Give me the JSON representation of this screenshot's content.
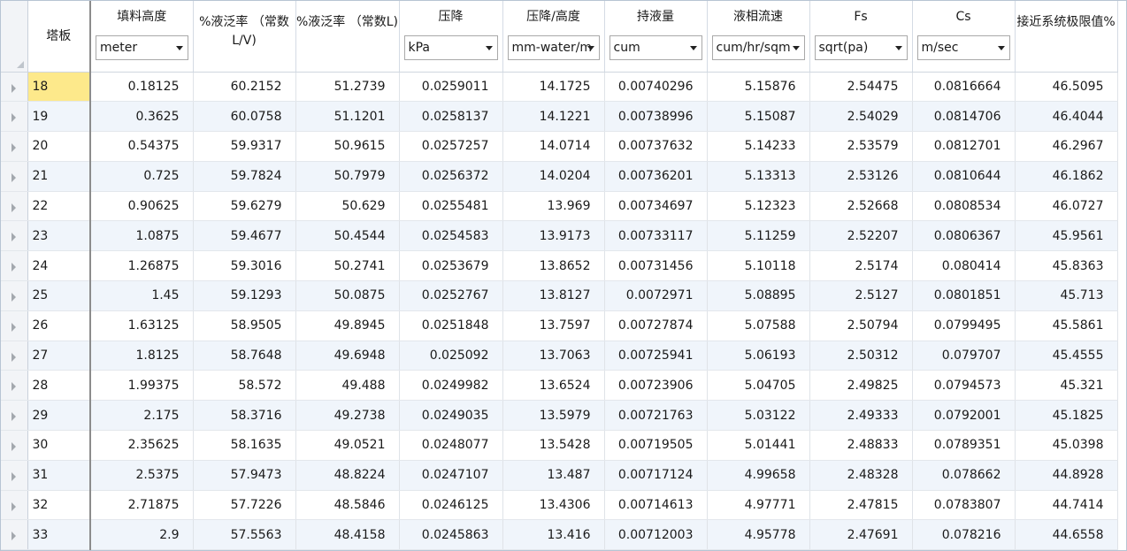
{
  "columns": [
    {
      "label": "塔板",
      "unit": null
    },
    {
      "label": "填料高度",
      "unit": "meter"
    },
    {
      "label": "%液泛率 （常数L/V)",
      "unit": null
    },
    {
      "label": "%液泛率 （常数L)",
      "unit": null
    },
    {
      "label": "压降",
      "unit": "kPa"
    },
    {
      "label": "压降/高度",
      "unit": "mm-water/m"
    },
    {
      "label": "持液量",
      "unit": "cum"
    },
    {
      "label": "液相流速",
      "unit": "cum/hr/sqm"
    },
    {
      "label": "Fs",
      "unit": "sqrt(pa)"
    },
    {
      "label": "Cs",
      "unit": "m/sec"
    },
    {
      "label": "接近系统极限值%",
      "unit": null
    }
  ],
  "rows": [
    [
      "18",
      "0.18125",
      "60.2152",
      "51.2739",
      "0.0259011",
      "14.1725",
      "0.00740296",
      "5.15876",
      "2.54475",
      "0.0816664",
      "46.5095"
    ],
    [
      "19",
      "0.3625",
      "60.0758",
      "51.1201",
      "0.0258137",
      "14.1221",
      "0.00738996",
      "5.15087",
      "2.54029",
      "0.0814706",
      "46.4044"
    ],
    [
      "20",
      "0.54375",
      "59.9317",
      "50.9615",
      "0.0257257",
      "14.0714",
      "0.00737632",
      "5.14233",
      "2.53579",
      "0.0812701",
      "46.2967"
    ],
    [
      "21",
      "0.725",
      "59.7824",
      "50.7979",
      "0.0256372",
      "14.0204",
      "0.00736201",
      "5.13313",
      "2.53126",
      "0.0810644",
      "46.1862"
    ],
    [
      "22",
      "0.90625",
      "59.6279",
      "50.629",
      "0.0255481",
      "13.969",
      "0.00734697",
      "5.12323",
      "2.52668",
      "0.0808534",
      "46.0727"
    ],
    [
      "23",
      "1.0875",
      "59.4677",
      "50.4544",
      "0.0254583",
      "13.9173",
      "0.00733117",
      "5.11259",
      "2.52207",
      "0.0806367",
      "45.9561"
    ],
    [
      "24",
      "1.26875",
      "59.3016",
      "50.2741",
      "0.0253679",
      "13.8652",
      "0.00731456",
      "5.10118",
      "2.5174",
      "0.080414",
      "45.8363"
    ],
    [
      "25",
      "1.45",
      "59.1293",
      "50.0875",
      "0.0252767",
      "13.8127",
      "0.0072971",
      "5.08895",
      "2.5127",
      "0.0801851",
      "45.713"
    ],
    [
      "26",
      "1.63125",
      "58.9505",
      "49.8945",
      "0.0251848",
      "13.7597",
      "0.00727874",
      "5.07588",
      "2.50794",
      "0.0799495",
      "45.5861"
    ],
    [
      "27",
      "1.8125",
      "58.7648",
      "49.6948",
      "0.025092",
      "13.7063",
      "0.00725941",
      "5.06193",
      "2.50312",
      "0.079707",
      "45.4555"
    ],
    [
      "28",
      "1.99375",
      "58.572",
      "49.488",
      "0.0249982",
      "13.6524",
      "0.00723906",
      "5.04705",
      "2.49825",
      "0.0794573",
      "45.321"
    ],
    [
      "29",
      "2.175",
      "58.3716",
      "49.2738",
      "0.0249035",
      "13.5979",
      "0.00721763",
      "5.03122",
      "2.49333",
      "0.0792001",
      "45.1825"
    ],
    [
      "30",
      "2.35625",
      "58.1635",
      "49.0521",
      "0.0248077",
      "13.5428",
      "0.00719505",
      "5.01441",
      "2.48833",
      "0.0789351",
      "45.0398"
    ],
    [
      "31",
      "2.5375",
      "57.9473",
      "48.8224",
      "0.0247107",
      "13.487",
      "0.00717124",
      "4.99658",
      "2.48328",
      "0.078662",
      "44.8928"
    ],
    [
      "32",
      "2.71875",
      "57.7226",
      "48.5846",
      "0.0246125",
      "13.4306",
      "0.00714613",
      "4.97771",
      "2.47815",
      "0.0783807",
      "44.7414"
    ],
    [
      "33",
      "2.9",
      "57.5563",
      "48.4158",
      "0.0245863",
      "13.416",
      "0.00712003",
      "4.95778",
      "2.47691",
      "0.078216",
      "44.6558"
    ]
  ],
  "selected_row_index": 0,
  "colors": {
    "selected_cell": "#fde98b",
    "alt_row": "#f0f5fb"
  }
}
